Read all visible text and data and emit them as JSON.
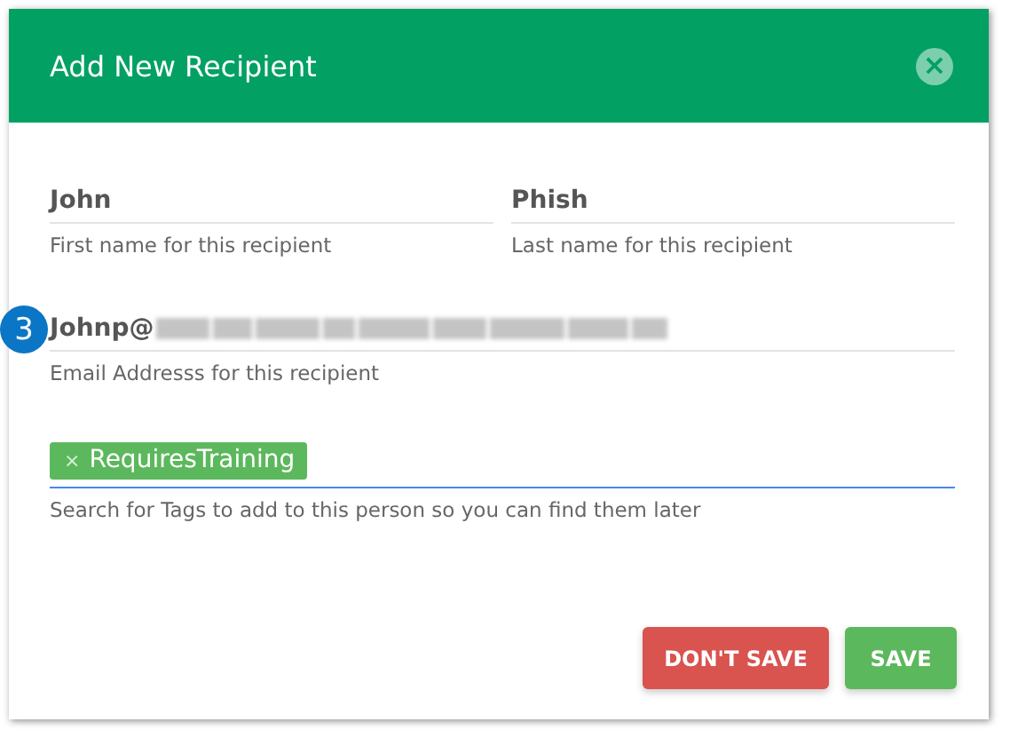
{
  "step_badge": "3",
  "dialog": {
    "title": "Add New Recipient",
    "close_symbol": "×"
  },
  "name_fields": [
    {
      "value": "John",
      "helper": "First name for this recipient"
    },
    {
      "value": "Phish",
      "helper": "Last name for this recipient"
    }
  ],
  "email_field": {
    "value": "Johnp@",
    "redacted": true,
    "helper": "Email Addresss for this recipient"
  },
  "tags_field": {
    "tags": [
      {
        "remove_symbol": "×",
        "label": "RequiresTraining"
      }
    ],
    "focused": true,
    "helper": "Search for Tags to add to this person so you can find them later"
  },
  "buttons": [
    {
      "kind": "danger",
      "label": "DON'T SAVE"
    },
    {
      "kind": "primary",
      "label": "SAVE"
    }
  ]
}
